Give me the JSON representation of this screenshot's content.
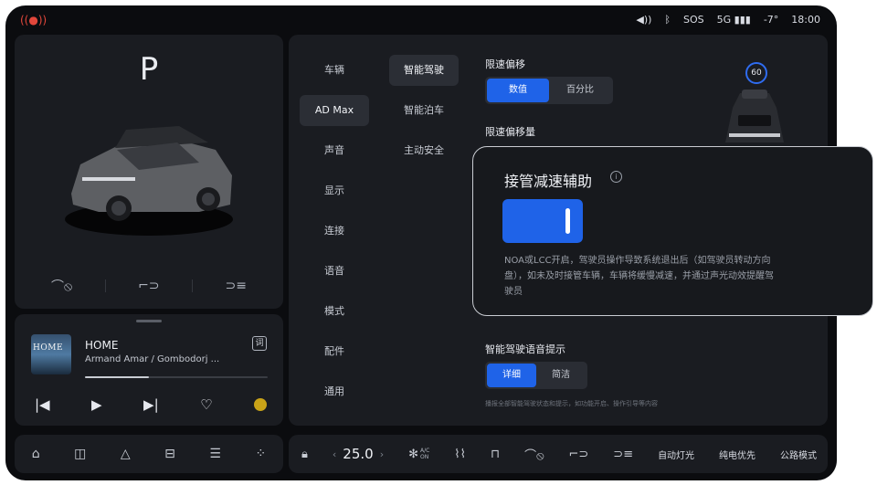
{
  "status": {
    "left_icon": "brake-warning-icon",
    "volume_icon": "volume-icon",
    "bluetooth_icon": "bluetooth-icon",
    "sos": "SOS",
    "network": "5G",
    "signal_icon": "signal-icon",
    "temperature": "-7°",
    "time": "18:00"
  },
  "vehicle": {
    "gear": "P",
    "actions": [
      "front-door-icon",
      "liftgate-icon",
      "headlight-icon"
    ]
  },
  "media": {
    "album_art_text": "HOME",
    "title": "HOME",
    "artist": "Armand Amar / Gombodorj ...",
    "lyrics_button": "词",
    "progress": 0.35,
    "controls": [
      "previous-icon",
      "play-icon",
      "next-icon",
      "favorite-icon",
      "source-icon"
    ]
  },
  "settings": {
    "nav_col1": [
      "车辆",
      "AD Max",
      "声音",
      "显示",
      "连接",
      "语音",
      "模式",
      "配件",
      "通用"
    ],
    "nav_col2": [
      "智能驾驶",
      "智能泊车",
      "主动安全"
    ],
    "active_col1": "AD Max",
    "active_col2": "智能驾驶",
    "speed_offset_label": "限速偏移",
    "speed_offset_options": [
      "数值",
      "百分比"
    ],
    "speed_offset_selected": "数值",
    "speed_offset_amount_label": "限速偏移量",
    "speed_limit_badge": "60",
    "voice_prompt_label": "智能驾驶语音提示",
    "voice_prompt_options": [
      "详细",
      "简洁"
    ],
    "voice_prompt_selected": "详细",
    "voice_prompt_note": "播报全部智能驾驶状态和提示，如功能开启、操作引导等内容"
  },
  "popup": {
    "title": "接管减速辅助",
    "info_icon": "info-icon",
    "toggle_on": true,
    "description": "NOA或LCC开启，驾驶员操作导致系统退出后（如驾驶员转动方向盘），如未及时接管车辆，车辆将缓慢减速，并通过声光动效提醒驾驶员"
  },
  "dock_left": [
    "home-icon",
    "media-icon",
    "navigation-icon",
    "car-icon",
    "apps-split-icon",
    "grid-icon"
  ],
  "dock_right": {
    "lock_icon": "lock-icon",
    "temperature": "25.0",
    "ac_label": "A/C",
    "ac_state": "ON",
    "auto_light": "自动灯光",
    "ev_priority": "纯电优先",
    "road_mode": "公路模式"
  },
  "colors": {
    "accent": "#1f63e8",
    "background": "#0b0c0f",
    "panel": "#1a1c21"
  }
}
